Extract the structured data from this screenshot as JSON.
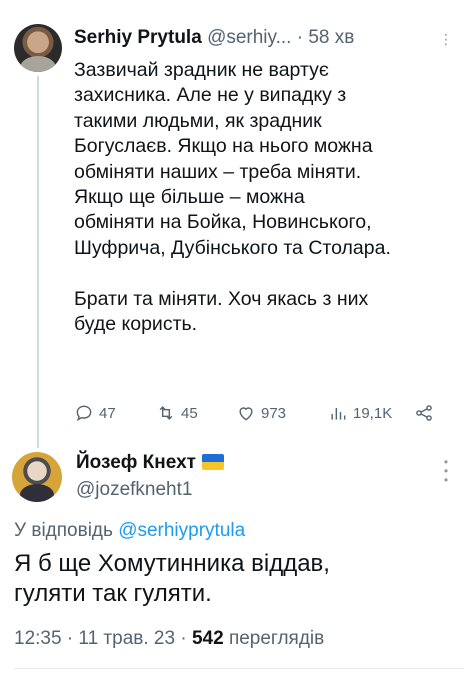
{
  "tweet": {
    "author_name": "Serhiy Prytula",
    "handle": "@serhiy...",
    "separator": "·",
    "time": "58 хв",
    "text": "Зазвичай зрадник не вартує\nзахисника. Але не у випадку з\nтакими людьми, як зрадник\nБогуслаєв. Якщо на нього можна\nобміняти наших – треба міняти.\nЯкщо ще більше – можна\nобміняти на Бойка, Новинського,\nШуфрича, Дубінського та Столара.\n\nБрати та міняти. Хоч якась з них\nбуде користь.",
    "actions": {
      "replies": "47",
      "retweets": "45",
      "likes": "973",
      "views": "19,1K"
    }
  },
  "reply": {
    "author_name": "Йозеф Кнехт",
    "handle": "@jozefkneht1",
    "reply_prefix": "У відповідь",
    "reply_mention": "@serhiyprytula",
    "text": "Я б ще Хомутинника віддав,\nгуляти так гуляти.",
    "timestamp": "12:35 · 11 трав. 23 ·",
    "views_count": "542",
    "views_label": "переглядів"
  },
  "icons": [
    "more-icon",
    "reply-icon",
    "retweet-icon",
    "like-icon",
    "views-icon",
    "share-icon",
    "ukraine-flag-icon"
  ],
  "colors": {
    "accent": "#1d9bf0",
    "muted": "#536471",
    "text": "#0f1419"
  }
}
